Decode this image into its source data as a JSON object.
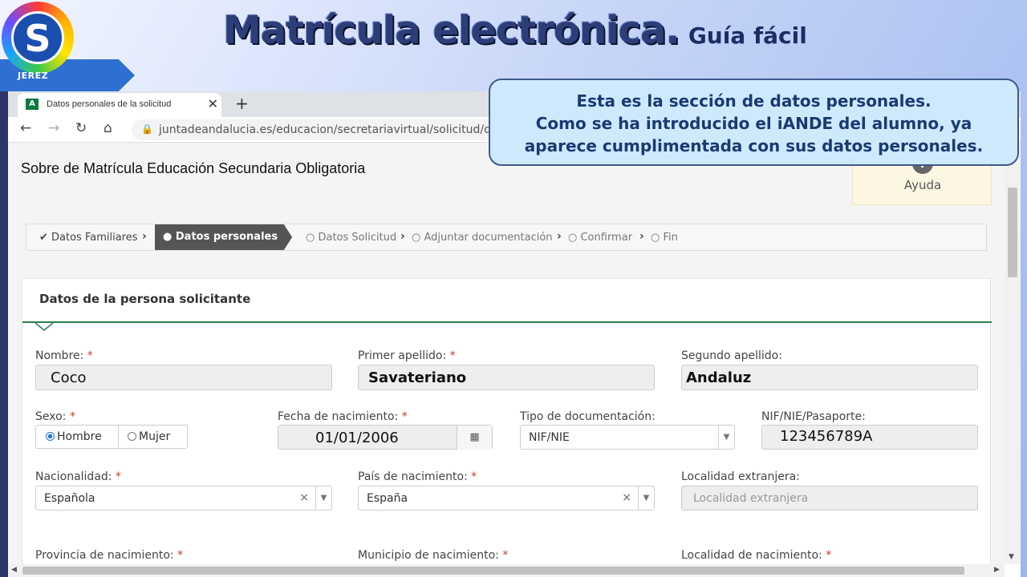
{
  "slide": {
    "title": "Matrícula electrónica.",
    "subtitle": "Guía fácil",
    "logo_text": "JEREZ"
  },
  "callout": {
    "lines": [
      "Esta es la sección de datos personales.",
      "Como se ha introducido el iANDE del alumno, ya",
      "aparece cumplimentada con sus datos personales."
    ]
  },
  "browser": {
    "tab_title": "Datos personales de la solicitud",
    "tab_favicon": "A",
    "tab_close": "✕",
    "new_tab": "+",
    "url": "juntadeandalucia.es/educacion/secretariavirtual/solicitud/datos"
  },
  "page": {
    "title": "Sobre de Matrícula Educación Secundaria Obligatoria",
    "help_label": "Ayuda",
    "steps": [
      {
        "label": "Datos Familiares",
        "state": "done"
      },
      {
        "label": "Datos personales",
        "state": "active"
      },
      {
        "label": "Datos Solicitud",
        "state": "pending"
      },
      {
        "label": "Adjuntar documentación",
        "state": "pending"
      },
      {
        "label": "Confirmar",
        "state": "pending"
      },
      {
        "label": "Fin",
        "state": "pending"
      }
    ],
    "section_title": "Datos de la persona solicitante",
    "required_mark": "*",
    "fields": {
      "nombre_label": "Nombre:",
      "nombre_value": "Coco",
      "primer_apellido_label": "Primer apellido:",
      "primer_apellido_value": "Savateriano",
      "segundo_apellido_label": "Segundo apellido:",
      "segundo_apellido_value": "Andaluz",
      "sexo_label": "Sexo:",
      "sexo_options": [
        "Hombre",
        "Mujer"
      ],
      "sexo_selected": "Hombre",
      "fecha_label": "Fecha de nacimiento:",
      "fecha_value": "01/01/2006",
      "tipo_doc_label": "Tipo de documentación:",
      "tipo_doc_value": "NIF/NIE",
      "nif_label": "NIF/NIE/Pasaporte:",
      "nif_value": "123456789A",
      "nacionalidad_label": "Nacionalidad:",
      "nacionalidad_value": "Española",
      "pais_label": "País de nacimiento:",
      "pais_value": "España",
      "localidad_ext_label": "Localidad extranjera:",
      "localidad_ext_placeholder": "Localidad extranjera",
      "provincia_label": "Provincia de nacimiento:",
      "municipio_label": "Municipio de nacimiento:",
      "localidad_nac_label": "Localidad de nacimiento:"
    }
  }
}
